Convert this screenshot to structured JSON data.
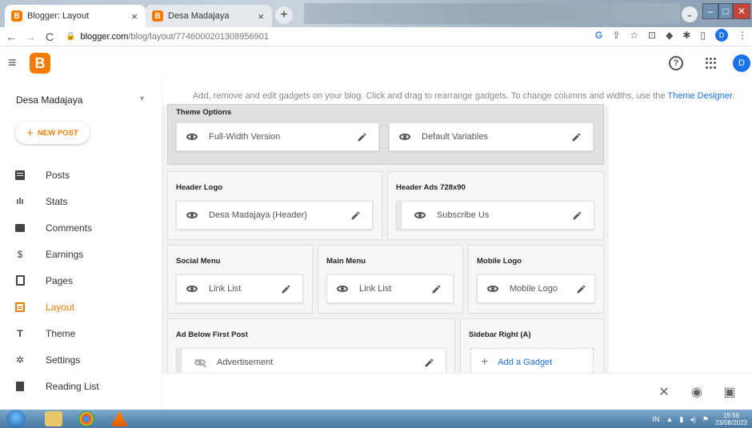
{
  "browser": {
    "tabs": [
      {
        "title": "Blogger: Layout",
        "favicon": "B",
        "active": true
      },
      {
        "title": "Desa Madajaya",
        "favicon": "B",
        "active": false
      }
    ],
    "url_host": "blogger.com",
    "url_path": "/blog/layout/7746000201308956901",
    "profile_initial": "D",
    "tab_search_glyph": "⌄"
  },
  "header": {
    "logo_letter": "B",
    "help_glyph": "?",
    "avatar_initial": "D"
  },
  "sidebar": {
    "blog_name": "Desa Madajaya",
    "new_post_label": "NEW POST",
    "items": [
      {
        "label": "Posts",
        "icon": "posts-icon"
      },
      {
        "label": "Stats",
        "icon": "stats-icon"
      },
      {
        "label": "Comments",
        "icon": "comments-icon"
      },
      {
        "label": "Earnings",
        "icon": "dollar-icon"
      },
      {
        "label": "Pages",
        "icon": "pages-icon"
      },
      {
        "label": "Layout",
        "icon": "layout-icon",
        "active": true
      },
      {
        "label": "Theme",
        "icon": "paint-roller-icon"
      },
      {
        "label": "Settings",
        "icon": "gear-icon"
      },
      {
        "label": "Reading List",
        "icon": "bookmark-icon"
      }
    ]
  },
  "main": {
    "info_text": "Add, remove and edit gadgets on your blog. Click and drag to rearrange gadgets. To change columns and widths, use the ",
    "info_link": "Theme Designer",
    "info_end": ".",
    "sections": {
      "theme_options": {
        "title": "Theme Options",
        "gadgets": [
          "Full-Width Version",
          "Default Variables"
        ]
      },
      "header_logo": {
        "title": "Header Logo",
        "gadget": "Desa Madajaya (Header)"
      },
      "header_ads": {
        "title": "Header Ads 728x90",
        "gadget": "Subscribe Us"
      },
      "social_menu": {
        "title": "Social Menu",
        "gadget": "Link List"
      },
      "main_menu": {
        "title": "Main Menu",
        "gadget": "Link List"
      },
      "mobile_logo": {
        "title": "Mobile Logo",
        "gadget": "Mobile Logo"
      },
      "ad_below": {
        "title": "Ad Below First Post",
        "gadget": "Advertisement"
      },
      "sidebar_right": {
        "title": "Sidebar Right (A)",
        "add_label": "Add a Gadget"
      }
    }
  },
  "actions": {
    "close_glyph": "✕",
    "preview_glyph": "◉",
    "save_glyph": "▣"
  },
  "taskbar": {
    "lang": "IN",
    "time": "19:59",
    "date": "23/08/2023"
  }
}
